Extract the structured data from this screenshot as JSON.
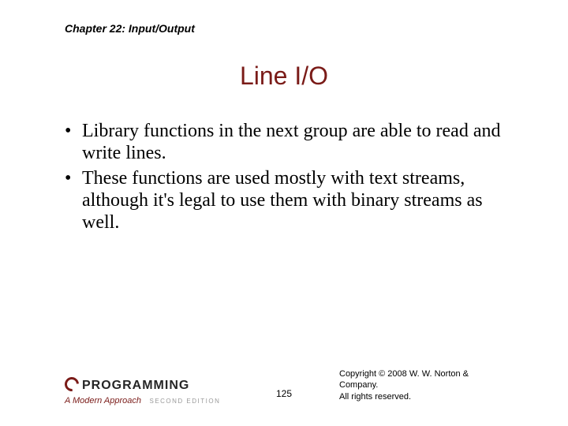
{
  "chapter": "Chapter 22: Input/Output",
  "title": "Line I/O",
  "bullets": [
    "Library functions in the next group are able to read and write lines.",
    "These functions are used mostly with text streams, although it's legal to use them with binary streams as well."
  ],
  "logo": {
    "word": "PROGRAMMING",
    "sub": "A Modern Approach",
    "edition": "SECOND EDITION"
  },
  "page": "125",
  "copyright_line1": "Copyright © 2008 W. W. Norton & Company.",
  "copyright_line2": "All rights reserved."
}
